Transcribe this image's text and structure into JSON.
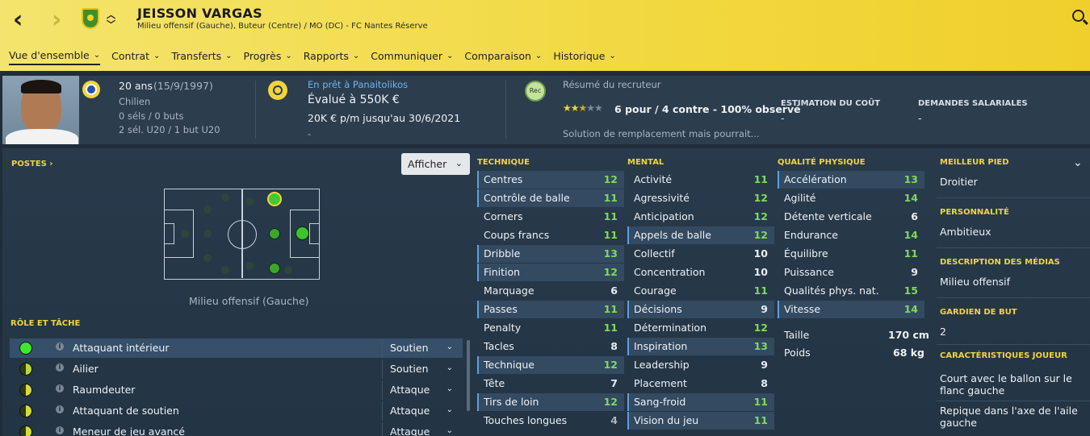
{
  "header": {
    "player_name": "JEISSON VARGAS",
    "subtitle": "Milieu offensif (Gauche), Buteur (Centre) / MO (DC) - FC Nantes Réserve",
    "back_icon": "chevron-left-icon",
    "forward_icon": "chevron-right-icon",
    "search_icon": "search-icon",
    "tabs": [
      {
        "label": "Vue d'ensemble",
        "active": true
      },
      {
        "label": "Contrat"
      },
      {
        "label": "Transferts"
      },
      {
        "label": "Progrès"
      },
      {
        "label": "Rapports"
      },
      {
        "label": "Communiquer"
      },
      {
        "label": "Comparaison"
      },
      {
        "label": "Historique"
      }
    ]
  },
  "info": {
    "age": "20 ans",
    "dob": "(15/9/1997)",
    "nationality": "Chilien",
    "caps": "0 séls / 0 buts",
    "youth": "2 sél. U20 / 1 but U20",
    "loan_status": "En prêt à Panaitolikos",
    "value": "Évalué à 550K €",
    "wage": "20K € p/m jusqu'au 30/6/2021",
    "dash": "-",
    "scout_badge": "Rec",
    "scout_title": "Résumé du recruteur",
    "scout_stars": 2.5,
    "scout_summary": "6 pour / 4 contre - 100% observé",
    "scout_note": "Solution de remplacement mais pourrait...",
    "cost_label": "ESTIMATION DU COÛT",
    "cost_value": "-",
    "wage_label": "DEMANDES SALARIALES",
    "wage_value": "-"
  },
  "positions": {
    "heading": "POSTES ›",
    "afficher": "Afficher",
    "position_label": "Milieu offensif (Gauche)"
  },
  "roles": {
    "heading": "RÔLE ET TÂCHE",
    "items": [
      {
        "name": "Attaquant intérieur",
        "duty": "Soutien",
        "rating": "full"
      },
      {
        "name": "Ailier",
        "duty": "Soutien",
        "rating": "half"
      },
      {
        "name": "Raumdeuter",
        "duty": "Attaque",
        "rating": "half"
      },
      {
        "name": "Attaquant de soutien",
        "duty": "Attaque",
        "rating": "half"
      },
      {
        "name": "Meneur de jeu avancé",
        "duty": "Attaque",
        "rating": "half"
      }
    ]
  },
  "technique": {
    "heading": "TECHNIQUE",
    "attrs": [
      {
        "name": "Centres",
        "value": "12",
        "hl": true
      },
      {
        "name": "Contrôle de balle",
        "value": "11",
        "hl": true
      },
      {
        "name": "Corners",
        "value": "11",
        "hl": false
      },
      {
        "name": "Coups francs",
        "value": "11",
        "hl": false
      },
      {
        "name": "Dribble",
        "value": "13",
        "hl": true
      },
      {
        "name": "Finition",
        "value": "12",
        "hl": true
      },
      {
        "name": "Marquage",
        "value": "6",
        "hl": false
      },
      {
        "name": "Passes",
        "value": "11",
        "hl": true
      },
      {
        "name": "Penalty",
        "value": "11",
        "hl": false
      },
      {
        "name": "Tacles",
        "value": "8",
        "hl": false
      },
      {
        "name": "Technique",
        "value": "12",
        "hl": true
      },
      {
        "name": "Tête",
        "value": "7",
        "hl": false
      },
      {
        "name": "Tirs de loin",
        "value": "12",
        "hl": true
      },
      {
        "name": "Touches longues",
        "value": "4",
        "hl": false
      }
    ]
  },
  "mental": {
    "heading": "MENTAL",
    "attrs": [
      {
        "name": "Activité",
        "value": "11",
        "hl": false
      },
      {
        "name": "Agressivité",
        "value": "12",
        "hl": false
      },
      {
        "name": "Anticipation",
        "value": "12",
        "hl": false
      },
      {
        "name": "Appels de balle",
        "value": "12",
        "hl": true
      },
      {
        "name": "Collectif",
        "value": "10",
        "hl": false
      },
      {
        "name": "Concentration",
        "value": "10",
        "hl": false
      },
      {
        "name": "Courage",
        "value": "11",
        "hl": false
      },
      {
        "name": "Décisions",
        "value": "9",
        "hl": true
      },
      {
        "name": "Détermination",
        "value": "12",
        "hl": false
      },
      {
        "name": "Inspiration",
        "value": "13",
        "hl": true
      },
      {
        "name": "Leadership",
        "value": "9",
        "hl": false
      },
      {
        "name": "Placement",
        "value": "8",
        "hl": false
      },
      {
        "name": "Sang-froid",
        "value": "11",
        "hl": true
      },
      {
        "name": "Vision du jeu",
        "value": "11",
        "hl": true
      }
    ]
  },
  "physical": {
    "heading": "QUALITÉ PHYSIQUE",
    "attrs": [
      {
        "name": "Accélération",
        "value": "13",
        "hl": true
      },
      {
        "name": "Agilité",
        "value": "14",
        "hl": false
      },
      {
        "name": "Détente verticale",
        "value": "6",
        "hl": false
      },
      {
        "name": "Endurance",
        "value": "14",
        "hl": false
      },
      {
        "name": "Équilibre",
        "value": "11",
        "hl": false
      },
      {
        "name": "Puissance",
        "value": "9",
        "hl": false
      },
      {
        "name": "Qualités phys. nat.",
        "value": "15",
        "hl": false
      },
      {
        "name": "Vitesse",
        "value": "14",
        "hl": true
      }
    ],
    "height_label": "Taille",
    "height": "170 cm",
    "weight_label": "Poids",
    "weight": "68 kg"
  },
  "right_panel": {
    "foot_label": "MEILLEUR PIED",
    "foot": "Droitier",
    "personality_label": "PERSONNALITÉ",
    "personality": "Ambitieux",
    "media_label": "DESCRIPTION DES MÉDIAS",
    "media": "Milieu offensif",
    "gk_label": "GARDIEN DE BUT",
    "gk": "2",
    "traits_label": "CARACTÉRISTIQUES JOUEUR",
    "traits": [
      "Court avec le ballon sur le flanc gauche",
      "Repique dans l'axe de l'aile gauche"
    ]
  }
}
